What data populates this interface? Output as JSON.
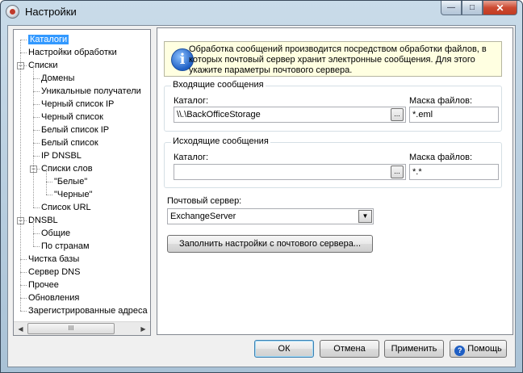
{
  "window": {
    "title": "Настройки",
    "caption": {
      "minimize": "—",
      "maximize": "□",
      "close": "✕"
    }
  },
  "tree": {
    "items": [
      {
        "label": "Каталоги",
        "level": 0,
        "selected": true
      },
      {
        "label": "Настройки обработки",
        "level": 0
      },
      {
        "label": "Списки",
        "level": 0,
        "expanded": true
      },
      {
        "label": "Домены",
        "level": 1
      },
      {
        "label": "Уникальные получатели",
        "level": 1
      },
      {
        "label": "Черный список IP",
        "level": 1
      },
      {
        "label": "Черный список",
        "level": 1
      },
      {
        "label": "Белый список IP",
        "level": 1
      },
      {
        "label": "Белый список",
        "level": 1
      },
      {
        "label": "IP DNSBL",
        "level": 1
      },
      {
        "label": "Списки слов",
        "level": 1,
        "expanded": true
      },
      {
        "label": "\"Белые\"",
        "level": 2
      },
      {
        "label": "\"Черные\"",
        "level": 2
      },
      {
        "label": "Список URL",
        "level": 1
      },
      {
        "label": "DNSBL",
        "level": 0,
        "expanded": true
      },
      {
        "label": "Общие",
        "level": 1
      },
      {
        "label": "По странам",
        "level": 1
      },
      {
        "label": "Чистка базы",
        "level": 0
      },
      {
        "label": "Сервер DNS",
        "level": 0
      },
      {
        "label": "Прочее",
        "level": 0
      },
      {
        "label": "Обновления",
        "level": 0
      },
      {
        "label": "Зарегистрированные адреса",
        "level": 0
      }
    ],
    "expander_minus": "−",
    "scroll": {
      "left": "◀",
      "right": "▶",
      "grip": "III"
    }
  },
  "info": {
    "icon": "i",
    "text": "Обработка сообщений производится посредством обработки файлов, в которых почтовый сервер хранит электронные сообщения. Для этого укажите параметры почтового сервера."
  },
  "incoming": {
    "title": "Входящие сообщения",
    "dir_label": "Каталог:",
    "dir_value": "\\\\.\\BackOfficeStorage",
    "mask_label": "Маска файлов:",
    "mask_value": "*.eml",
    "browse": "..."
  },
  "outgoing": {
    "title": "Исходящие сообщения",
    "dir_label": "Каталог:",
    "dir_value": "",
    "mask_label": "Маска файлов:",
    "mask_value": "*.*",
    "browse": "..."
  },
  "mail_server": {
    "label": "Почтовый сервер:",
    "value": "ExchangeServer",
    "arrow": "▼",
    "fill_button": "Заполнить настройки с почтового сервера..."
  },
  "buttons": {
    "ok": "ОК",
    "cancel": "Отмена",
    "apply": "Применить",
    "help": "Помощь",
    "help_icon": "?"
  }
}
